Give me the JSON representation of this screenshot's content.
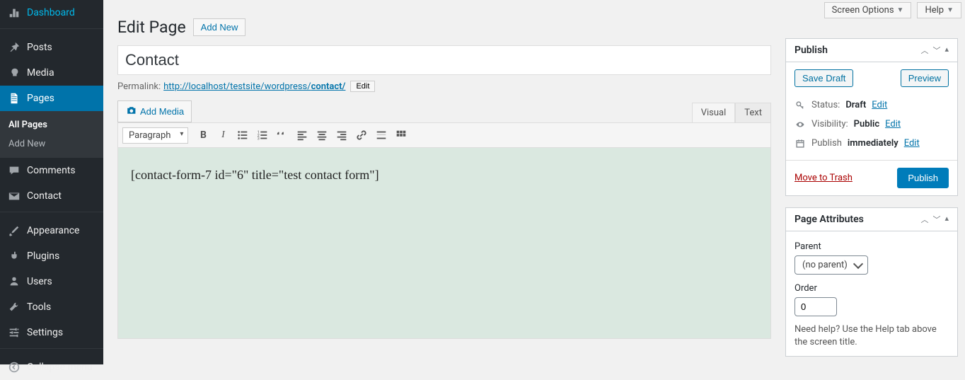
{
  "topbar": {
    "screen_options": "Screen Options",
    "help": "Help"
  },
  "sidebar": {
    "dashboard": "Dashboard",
    "posts": "Posts",
    "media": "Media",
    "pages": "Pages",
    "pages_sub": {
      "all": "All Pages",
      "add_new": "Add New"
    },
    "comments": "Comments",
    "contact": "Contact",
    "appearance": "Appearance",
    "plugins": "Plugins",
    "users": "Users",
    "tools": "Tools",
    "settings": "Settings",
    "collapse": "Collapse menu"
  },
  "header": {
    "title": "Edit Page",
    "add_new": "Add New"
  },
  "title_field": {
    "value": "Contact"
  },
  "permalink": {
    "label": "Permalink:",
    "base": "http://localhost/testsite/wordpress/",
    "slug": "contact/",
    "edit": "Edit"
  },
  "media_button": "Add Media",
  "editor_tabs": {
    "visual": "Visual",
    "text": "Text"
  },
  "format_select": "Paragraph",
  "editor_content": "[contact-form-7 id=\"6\" title=\"test contact form\"]",
  "publish_box": {
    "title": "Publish",
    "save_draft": "Save Draft",
    "preview": "Preview",
    "status_label": "Status:",
    "status_value": "Draft",
    "visibility_label": "Visibility:",
    "visibility_value": "Public",
    "publish_label": "Publish",
    "publish_value": "immediately",
    "edit": "Edit",
    "trash": "Move to Trash",
    "publish_btn": "Publish"
  },
  "attributes_box": {
    "title": "Page Attributes",
    "parent_label": "Parent",
    "parent_value": "(no parent)",
    "order_label": "Order",
    "order_value": "0",
    "help": "Need help? Use the Help tab above the screen title."
  }
}
